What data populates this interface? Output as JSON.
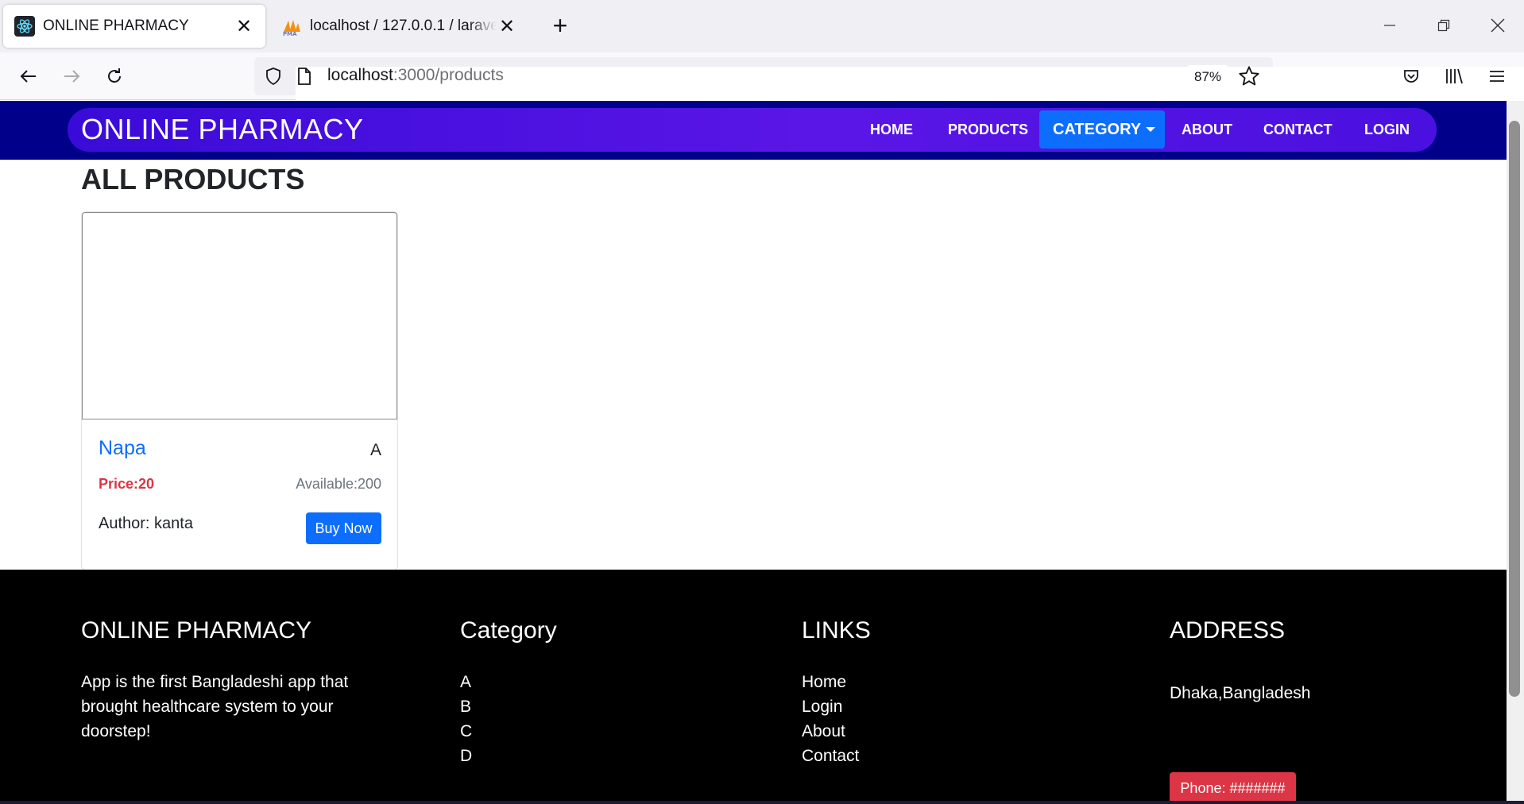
{
  "browser": {
    "tabs": [
      {
        "title": "ONLINE PHARMACY",
        "active": true
      },
      {
        "title": "localhost / 127.0.0.1 / laravelapi",
        "active": false
      }
    ],
    "url_host": "localhost",
    "url_rest": ":3000/products",
    "zoom": "87%"
  },
  "nav": {
    "brand": "ONLINE PHARMACY",
    "home": "HOME",
    "products": "PRODUCTS",
    "category": "CATEGORY",
    "about": "ABOUT",
    "contact": "CONTACT",
    "login": "LOGIN"
  },
  "main": {
    "title": "ALL PRODUCTS",
    "products": [
      {
        "name": "Napa",
        "category": "A",
        "price": "Price:20",
        "available": "Available:200",
        "author": "Author: kanta",
        "buy_label": "Buy Now"
      }
    ]
  },
  "footer": {
    "brand": "ONLINE PHARMACY",
    "description": "App is the first Bangladeshi app that brought healthcare system to your doorstep!",
    "category_heading": "Category",
    "categories": [
      "A",
      "B",
      "C",
      "D"
    ],
    "links_heading": "LINKS",
    "links": [
      "Home",
      "Login",
      "About",
      "Contact"
    ],
    "address_heading": "ADDRESS",
    "address": "Dhaka,Bangladesh",
    "phone": "Phone: #######"
  },
  "colors": {
    "header_bg": "#00008b",
    "nav_gradient": "#5a16e6",
    "primary": "#0d6efd",
    "danger": "#dc3545",
    "footer_bg": "#000000"
  }
}
